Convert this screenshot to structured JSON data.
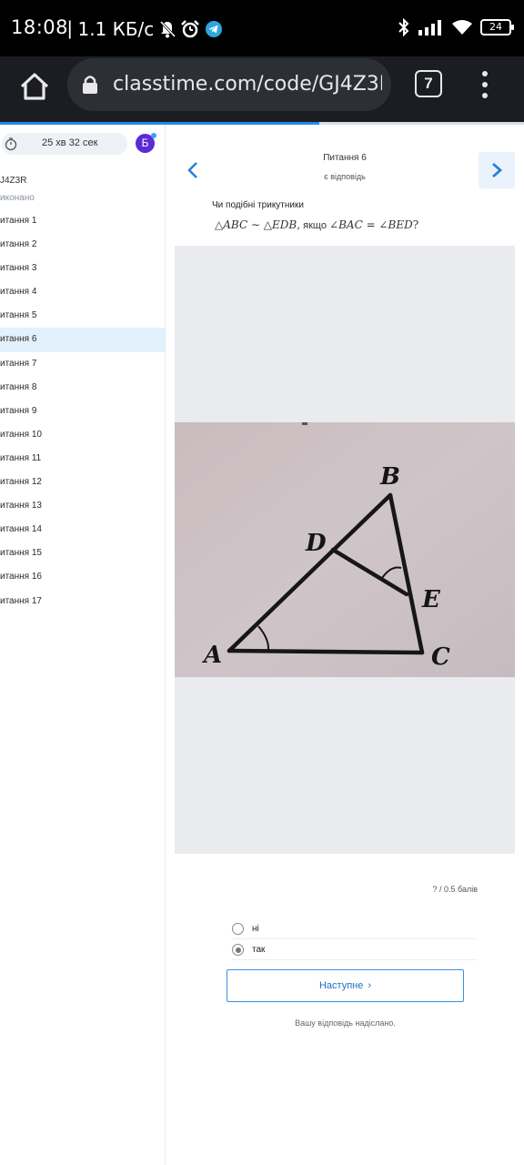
{
  "status_bar": {
    "time": "18:08",
    "speed": "1.1 КБ/с",
    "battery": "24"
  },
  "browser": {
    "url": "classtime.com/code/GJ4Z3R/",
    "tab_count": "7"
  },
  "page_progress": 0.61,
  "sidebar": {
    "timer": "25 хв 32 сек",
    "avatar_letter": "Б",
    "session_code": "J4Z3R",
    "status": "иконано",
    "questions": [
      "итання 1",
      "итання 2",
      "итання 3",
      "итання 4",
      "итання 5",
      "итання 6",
      "итання 7",
      "итання 8",
      "итання 9",
      "итання 10",
      "итання 11",
      "итання 12",
      "итання 13",
      "итання 14",
      "итання 15",
      "итання 16",
      "итання 17"
    ],
    "active_index": 5
  },
  "question": {
    "title": "Питання 6",
    "subtitle": "є відповідь",
    "prompt": "Чи подібні трикутники",
    "formula": {
      "p1": "△",
      "abc": "ABC",
      "sim": " ∼ △",
      "edb": "EDB",
      "comma": ",",
      "if": " якщо ",
      "ang1": "∠",
      "bac": "BAC",
      "eq": " = ∠",
      "bed": "BED",
      "q": "?"
    },
    "figure_labels": {
      "a": "A",
      "b": "B",
      "c": "C",
      "d": "D",
      "e": "E"
    },
    "points": "?  /  0.5  балів",
    "options": [
      {
        "label": "ні",
        "checked": false
      },
      {
        "label": "так",
        "checked": true
      }
    ],
    "next_button": "Наступне",
    "sent_message": "Вашу відповідь надіслано."
  }
}
